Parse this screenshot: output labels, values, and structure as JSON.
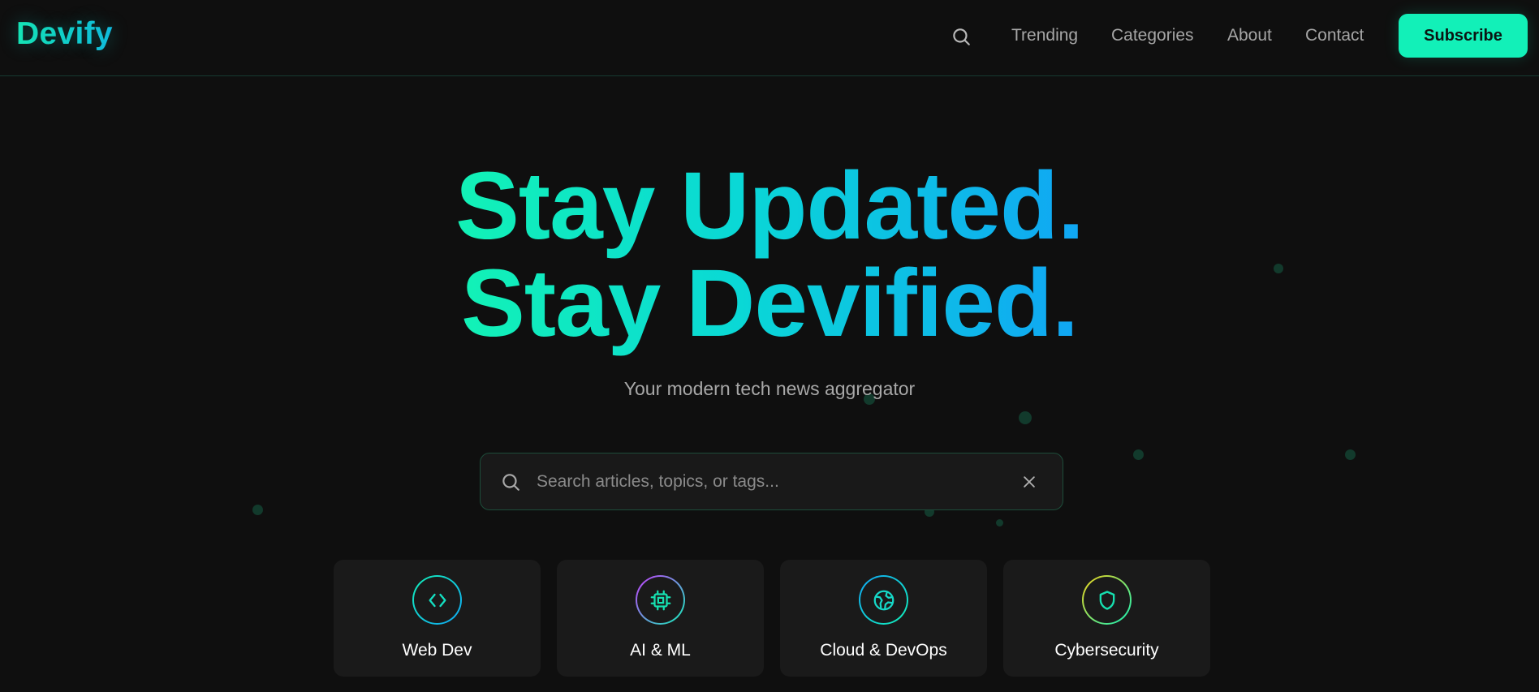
{
  "header": {
    "logo": "Devify",
    "nav": [
      "Trending",
      "Categories",
      "About",
      "Contact"
    ],
    "subscribe_label": "Subscribe",
    "search_icon": "search-icon"
  },
  "hero": {
    "line1": "Stay Updated.",
    "line2": "Stay Devified.",
    "subtitle": "Your modern tech news aggregator"
  },
  "search": {
    "placeholder": "Search articles, topics, or tags...",
    "value": "",
    "icon": "search-icon",
    "clear_icon": "close-icon"
  },
  "categories": [
    {
      "label": "Web Dev",
      "icon": "code-icon"
    },
    {
      "label": "AI & ML",
      "icon": "cpu-chip-icon"
    },
    {
      "label": "Cloud & DevOps",
      "icon": "globe-network-icon"
    },
    {
      "label": "Cybersecurity",
      "icon": "shield-icon"
    }
  ],
  "colors": {
    "background": "#0f0f0f",
    "accent": "#12f0b8",
    "accent_blue": "#10a6f4",
    "card_background": "#1a1a1a"
  }
}
